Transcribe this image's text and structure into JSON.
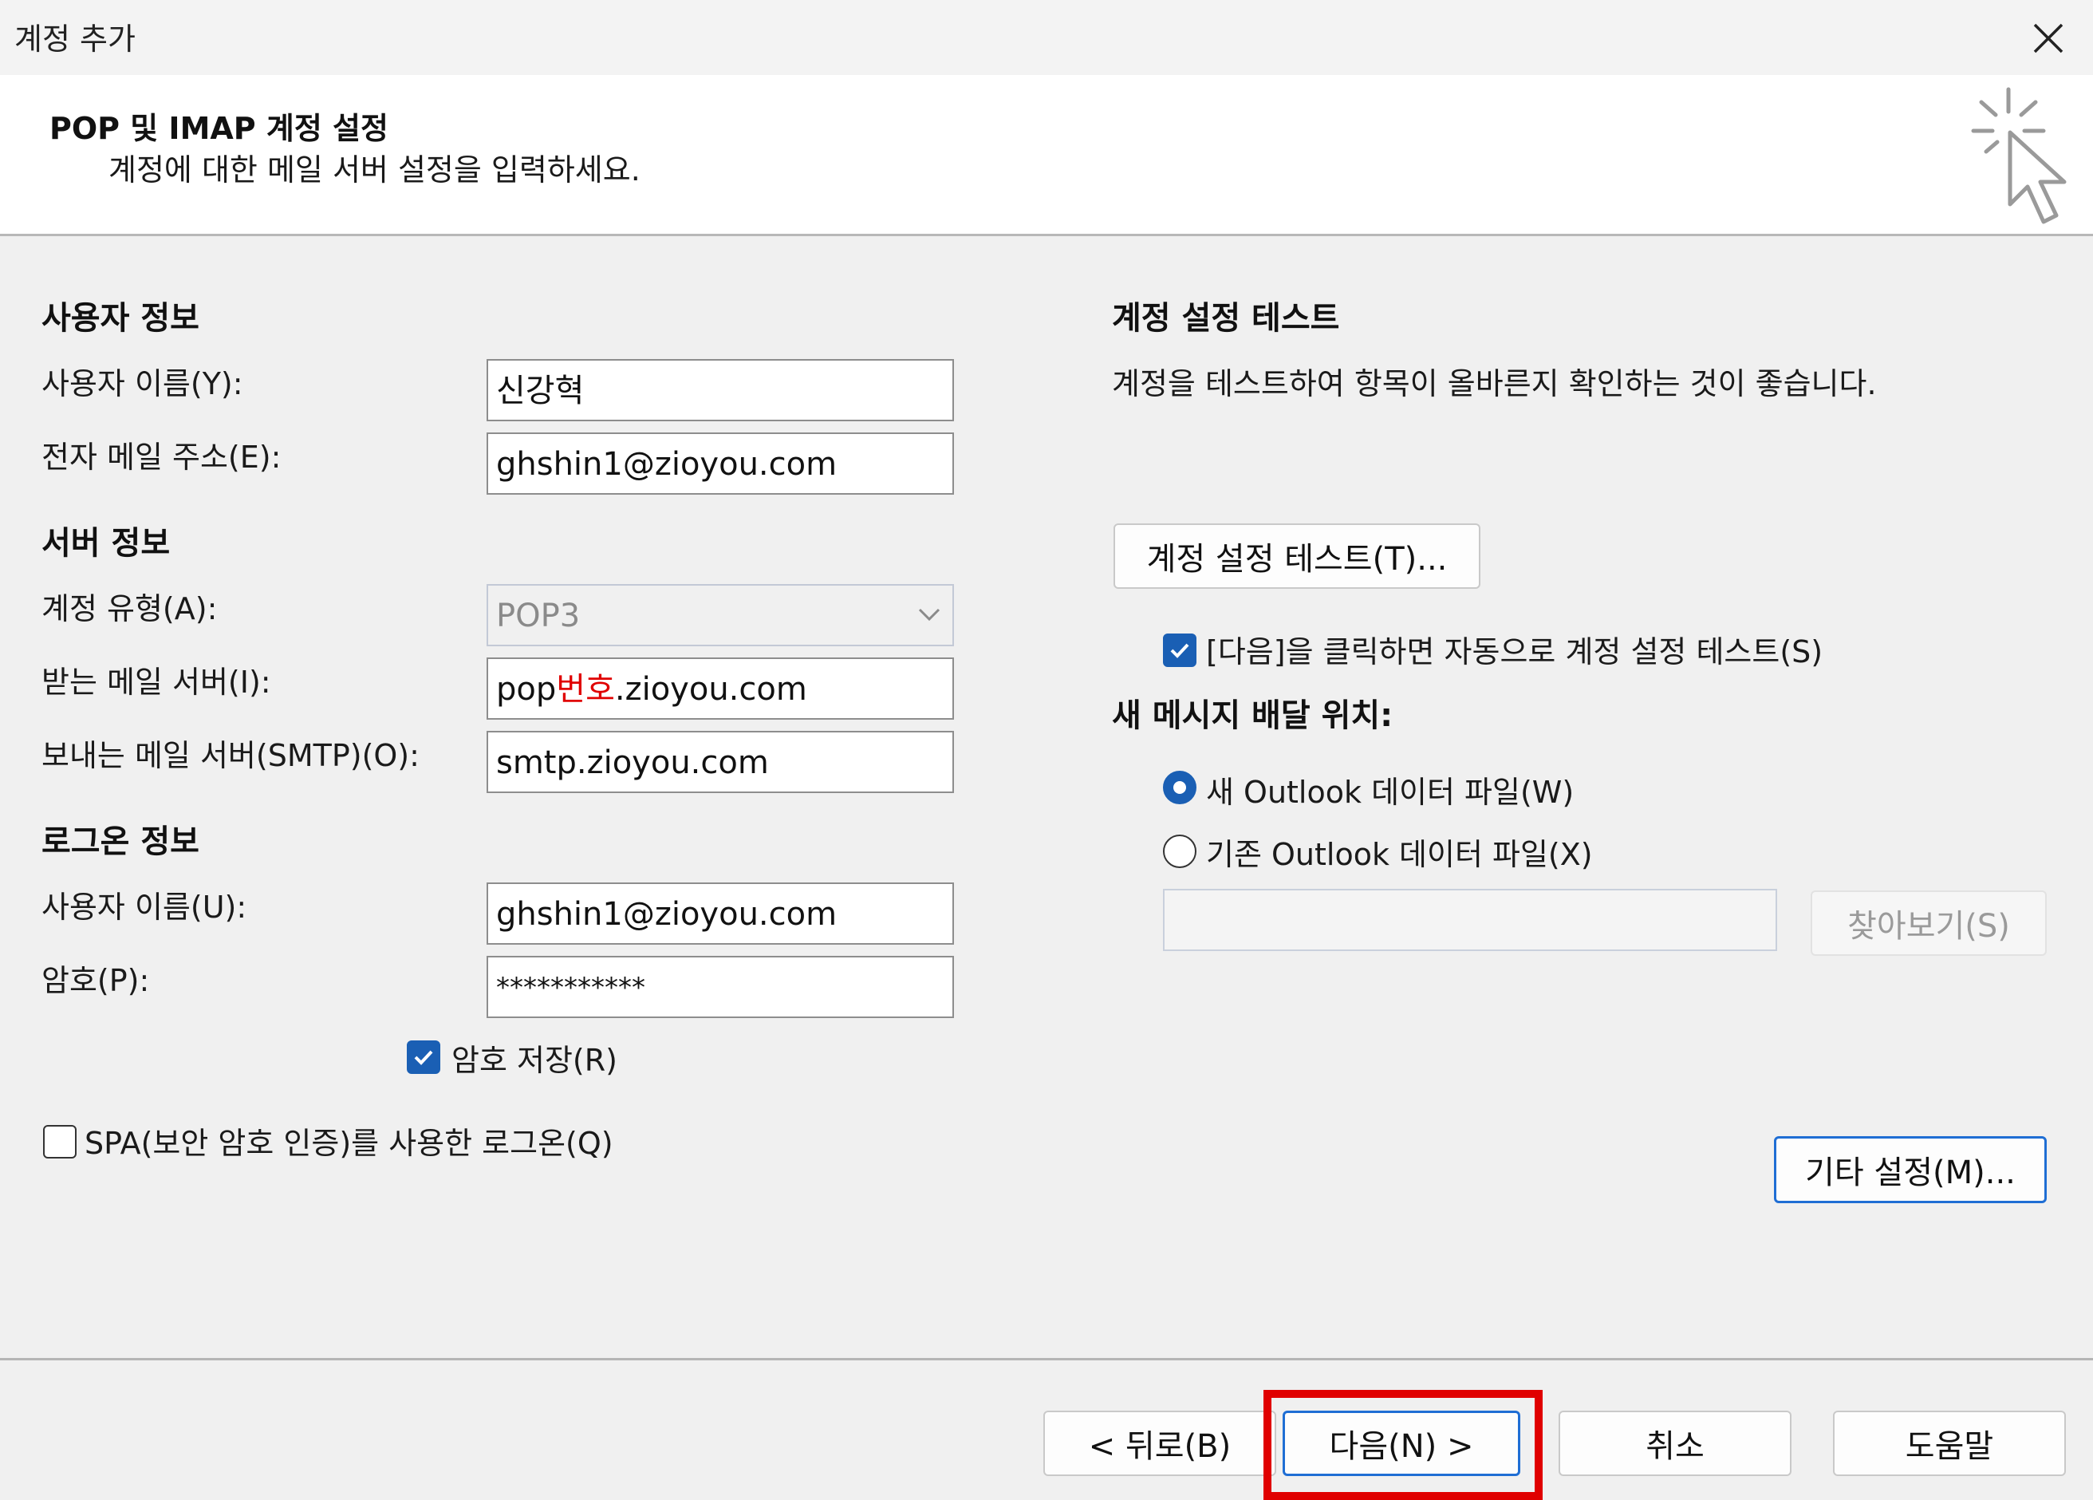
{
  "window": {
    "title": "계정 추가"
  },
  "header": {
    "title": "POP 및 IMAP 계정 설정",
    "subtitle": "계정에 대한 메일 서버 설정을 입력하세요."
  },
  "user_info": {
    "section_title": "사용자 정보",
    "name_label": "사용자 이름(Y):",
    "name_value": "신강혁",
    "email_label": "전자 메일 주소(E):",
    "email_value": "ghshin1@zioyou.com"
  },
  "server_info": {
    "section_title": "서버 정보",
    "account_type_label": "계정 유형(A):",
    "account_type_value": "POP3",
    "incoming_label": "받는 메일 서버(I):",
    "incoming_prefix": "pop",
    "incoming_highlight": "번호",
    "incoming_suffix": ".zioyou.com",
    "outgoing_label": "보내는 메일 서버(SMTP)(O):",
    "outgoing_value": "smtp.zioyou.com"
  },
  "logon_info": {
    "section_title": "로그온 정보",
    "username_label": "사용자 이름(U):",
    "username_value": "ghshin1@zioyou.com",
    "password_label": "암호(P):",
    "password_value": "***********",
    "remember_label": "암호 저장(R)",
    "remember_checked": true,
    "spa_label": "SPA(보안 암호 인증)를 사용한 로그온(Q)",
    "spa_checked": false
  },
  "test": {
    "section_title": "계정 설정 테스트",
    "description": "계정을 테스트하여 항목이 올바른지 확인하는 것이 좋습니다.",
    "test_button": "계정 설정 테스트(T)...",
    "auto_test_label": "[다음]을 클릭하면 자동으로 계정 설정 테스트(S)",
    "auto_test_checked": true
  },
  "delivery": {
    "section_title": "새 메시지 배달 위치:",
    "new_file_label": "새 Outlook 데이터 파일(W)",
    "existing_file_label": "기존 Outlook 데이터 파일(X)",
    "selected": "new",
    "existing_path": "",
    "browse_button": "찾아보기(S)"
  },
  "more_settings_button": "기타 설정(M)...",
  "footer": {
    "back": "< 뒤로(B)",
    "next": "다음(N) >",
    "cancel": "취소",
    "help": "도움말"
  },
  "colors": {
    "accent": "#1a5fb4",
    "highlight": "#e00000"
  }
}
